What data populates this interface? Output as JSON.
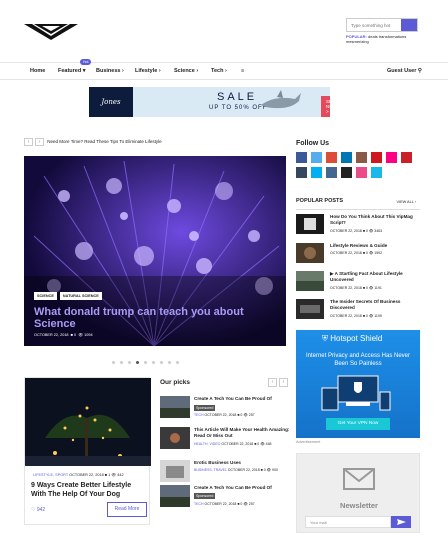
{
  "header": {
    "search_placeholder": "Type something hot",
    "popular_label": "POPULAR:",
    "popular_tags": "deals  transformations  mesmerizing"
  },
  "nav": {
    "items": [
      "Home",
      "Featured",
      "Business",
      "Lifestyle",
      "Science",
      "Tech"
    ],
    "hot_badge": "Hot",
    "user": "Guest User"
  },
  "banner": {
    "brand": "Jones",
    "sale": "SALE",
    "upto": "UP TO 50% OFF",
    "shop": "SHOP NOW >"
  },
  "ticker": {
    "text": "Need More Time? Read These Tips To Eliminate Lifestyle"
  },
  "hero": {
    "tags": [
      "SCIENCE",
      "NATURAL SCIENCE"
    ],
    "title": "What donald trump can teach you about Science",
    "date": "OCTOBER 22, 2018",
    "comments": "0",
    "views": "1094"
  },
  "slider": {
    "dot_count": 9,
    "active_index": 3
  },
  "feature_card": {
    "category": "LIFESTYLE, SPORT",
    "date": "OCTOBER 22, 2018",
    "comments": "1",
    "views": "442",
    "title": "9 Ways Create Better Lifestyle With The Help Of Your Dog",
    "likes": "942",
    "read_more": "Read More"
  },
  "our_picks": {
    "heading": "Our picks",
    "items": [
      {
        "title": "Create A Tech You Can Be Proud Of",
        "sponsored": "Sponsored",
        "category": "TECH",
        "date": "OCTOBER 22, 2018",
        "comments": "0",
        "views": "257"
      },
      {
        "title": "This Article Will Make Your Health Amazing: Read Or Miss Out",
        "sponsored": "",
        "category": "HEALTH, VIDEO",
        "date": "OCTOBER 22, 2018",
        "comments": "0",
        "views": "448"
      },
      {
        "title": "Erotic Business Uses",
        "sponsored": "",
        "category": "BUSINESS, TRAVEL",
        "date": "OCTOBER 22, 2018",
        "comments": "0",
        "views": "900"
      },
      {
        "title": "Create A Tech You Can Be Proud Of",
        "sponsored": "Sponsored",
        "category": "TECH",
        "date": "OCTOBER 22, 2018",
        "comments": "0",
        "views": "257"
      }
    ]
  },
  "sidebar": {
    "follow_heading": "Follow Us",
    "socials": [
      {
        "name": "facebook-icon",
        "color": "#3b5998"
      },
      {
        "name": "twitter-icon",
        "color": "#55acee"
      },
      {
        "name": "google-plus-icon",
        "color": "#dd4b39"
      },
      {
        "name": "linkedin-icon",
        "color": "#0077b5"
      },
      {
        "name": "instagram-icon",
        "color": "#8a5a44"
      },
      {
        "name": "youtube-icon",
        "color": "#cc181e"
      },
      {
        "name": "flickr-icon",
        "color": "#ff0084"
      },
      {
        "name": "pinterest-icon",
        "color": "#cb2027"
      },
      {
        "name": "tumblr-icon",
        "color": "#36465d"
      },
      {
        "name": "skype-icon",
        "color": "#00aff0"
      },
      {
        "name": "vk-icon",
        "color": "#45668e"
      },
      {
        "name": "github-icon",
        "color": "#222222"
      },
      {
        "name": "dribbble-icon",
        "color": "#ea4c89"
      },
      {
        "name": "vimeo-icon",
        "color": "#1ab7ea"
      }
    ],
    "popular_heading": "POPULAR POSTS",
    "view_all": "VIEW ALL",
    "popular_posts": [
      {
        "title": "How Do You Think About This VipMag Script?",
        "date": "OCTOBER 22, 2018",
        "comments": "0",
        "views": "3463"
      },
      {
        "title": "Lifestyle Reviews & Guide",
        "date": "OCTOBER 22, 2018",
        "comments": "0",
        "views": "1592"
      },
      {
        "title": "A Startling Fact About Lifestyle Uncovered",
        "date": "OCTOBER 22, 2018",
        "comments": "0",
        "views": "1191"
      },
      {
        "title": "The Insider Secrets Of Business Discovered",
        "date": "OCTOBER 22, 2018",
        "comments": "0",
        "views": "1199"
      }
    ],
    "ad": {
      "brand": "Hotspot Shield",
      "headline": "Internet Privacy and Access Has Never Been So Painless",
      "cta": "Get Your VPN Now"
    },
    "ad_label": "Advertisement",
    "newsletter": {
      "title": "Newsletter",
      "placeholder": "Your mail"
    }
  }
}
